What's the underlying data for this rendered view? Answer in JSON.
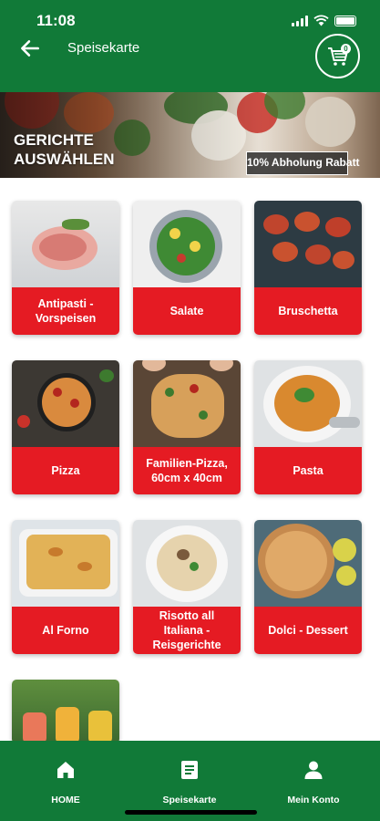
{
  "status_bar": {
    "time": "11:08"
  },
  "header": {
    "title": "Speisekarte",
    "cart_count": "0"
  },
  "hero": {
    "title": "Gerichte auswählen",
    "badge": "10% Abholung Rabatt"
  },
  "categories": [
    {
      "label": "Antipasti - Vorspeisen"
    },
    {
      "label": "Salate"
    },
    {
      "label": "Bruschetta"
    },
    {
      "label": "Pizza"
    },
    {
      "label": "Familien-Pizza, 60cm x 40cm"
    },
    {
      "label": "Pasta"
    },
    {
      "label": "Al Forno"
    },
    {
      "label": "Risotto all Italiana - Reisgerichte"
    },
    {
      "label": "Dolci - Dessert"
    },
    {
      "label": ""
    }
  ],
  "bottom_nav": {
    "home": "HOME",
    "menu": "Speisekarte",
    "account": "Mein Konto"
  },
  "colors": {
    "primary": "#117a38",
    "accent": "#e51b23"
  }
}
